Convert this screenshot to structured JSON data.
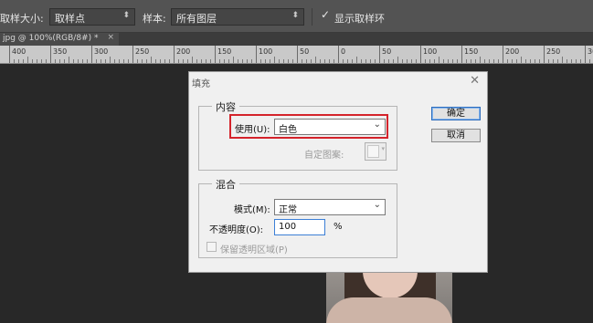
{
  "options_bar": {
    "sample_size_label": "取样大小:",
    "sample_size_value": "取样点",
    "sample_label": "样本:",
    "sample_value": "所有图层",
    "show_ring_label": "显示取样环",
    "show_ring_checked": true
  },
  "document_tab": {
    "title": "jpg @ 100%(RGB/8#) *",
    "close": "×"
  },
  "ruler": {
    "labels": [
      "400",
      "350",
      "300",
      "250",
      "200",
      "150",
      "100",
      "50",
      "0",
      "50",
      "100",
      "150",
      "200",
      "250",
      "300"
    ]
  },
  "dialog": {
    "title": "填充",
    "close_glyph": "✕",
    "content_group": {
      "legend": "内容",
      "use_label": "使用(U):",
      "use_value": "白色",
      "custom_pattern_label": "自定图案:"
    },
    "blend_group": {
      "legend": "混合",
      "mode_label": "模式(M):",
      "mode_value": "正常",
      "opacity_label": "不透明度(O):",
      "opacity_value": "100",
      "opacity_unit": "%",
      "preserve_label": "保留透明区域(P)"
    },
    "ok_button": "确定",
    "cancel_button": "取消"
  },
  "colors": {
    "highlight": "#d4232b",
    "primary_button_border": "#2d6dbd"
  },
  "icons": {
    "dropdown_arrow": "chevron-down-icon",
    "checkmark": "checkmark-icon",
    "close": "close-icon"
  }
}
